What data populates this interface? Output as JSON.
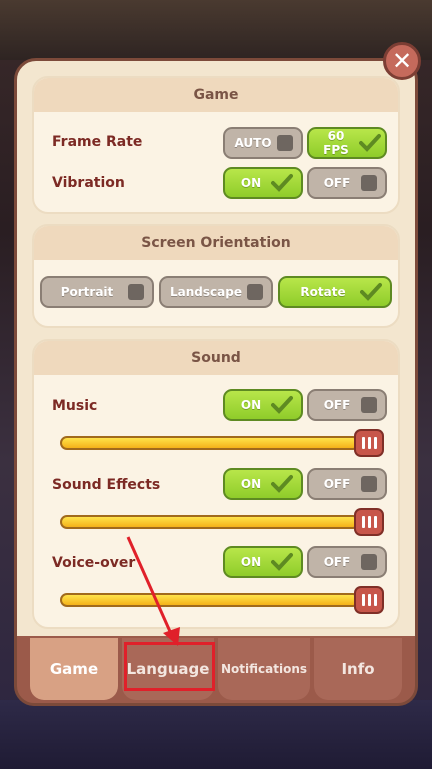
{
  "sections": {
    "game": {
      "title": "Game",
      "frame_rate": {
        "label": "Frame Rate",
        "auto": "AUTO",
        "fps": "60 FPS",
        "selected": "60 FPS"
      },
      "vibration": {
        "label": "Vibration",
        "on": "ON",
        "off": "OFF",
        "selected": "ON"
      }
    },
    "orientation": {
      "title": "Screen Orientation",
      "portrait": "Portrait",
      "landscape": "Landscape",
      "rotate": "Rotate",
      "selected": "Rotate"
    },
    "sound": {
      "title": "Sound",
      "music": {
        "label": "Music",
        "on": "ON",
        "off": "OFF",
        "selected": "ON",
        "level": 1.0
      },
      "effects": {
        "label": "Sound Effects",
        "on": "ON",
        "off": "OFF",
        "selected": "ON",
        "level": 1.0
      },
      "voice": {
        "label": "Voice-over",
        "on": "ON",
        "off": "OFF",
        "selected": "ON",
        "level": 1.0
      }
    }
  },
  "tabs": [
    {
      "label": "Game",
      "active": true
    },
    {
      "label": "Language",
      "active": false
    },
    {
      "label": "Notifications",
      "active": false
    },
    {
      "label": "Info",
      "active": false
    }
  ],
  "colors": {
    "on": "#9fd838",
    "off": "#c0b4a8",
    "title": "#7c2a24",
    "annotation": "#e0202a"
  }
}
